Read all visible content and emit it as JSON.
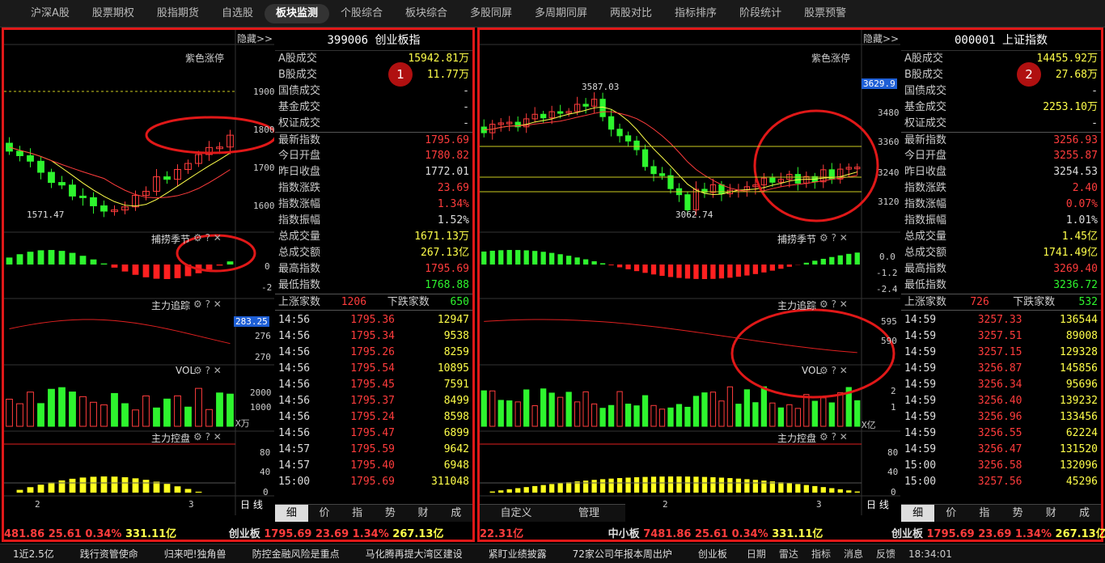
{
  "nav": [
    "沪深A股",
    "股票期权",
    "股指期货",
    "自选股",
    "板块监测",
    "个股综合",
    "板块综合",
    "多股同屏",
    "多周期同屏",
    "两股对比",
    "指标排序",
    "阶段统计",
    "股票预警"
  ],
  "nav_active": 4,
  "left": {
    "hide": "隐藏>>",
    "marker": "紫色涨停",
    "yaxis": [
      "1900",
      "1800",
      "1700",
      "1600"
    ],
    "low_label": "1571.47",
    "ind1": "捕捞季节",
    "ind1_axis": [
      "0",
      "-2"
    ],
    "ind2": "主力追踪",
    "ind2_axis": [
      "283.25",
      "276",
      "270"
    ],
    "vol": "VOL",
    "vol_axis": [
      "2000",
      "1000",
      "X万"
    ],
    "ind3": "主力控盘",
    "ind3_axis": [
      "80",
      "40",
      "0"
    ],
    "xlabels": [
      "2",
      "3"
    ],
    "period": "日 线",
    "badge": "1",
    "title": "399006  创业板指",
    "rows": [
      {
        "k": "A股成交",
        "v": "15942.81万",
        "c": "yel"
      },
      {
        "k": "B股成交",
        "v": "11.77万",
        "c": "yel"
      },
      {
        "k": "国债成交",
        "v": "-",
        "c": "wht"
      },
      {
        "k": "基金成交",
        "v": "-",
        "c": "wht"
      },
      {
        "k": "权证成交",
        "v": "-",
        "c": "wht"
      },
      {
        "k": "最新指数",
        "v": "1795.69",
        "c": "red"
      },
      {
        "k": "今日开盘",
        "v": "1780.82",
        "c": "red"
      },
      {
        "k": "昨日收盘",
        "v": "1772.01",
        "c": "wht"
      },
      {
        "k": "指数涨跌",
        "v": "23.69",
        "c": "red"
      },
      {
        "k": "指数涨幅",
        "v": "1.34%",
        "c": "red"
      },
      {
        "k": "指数振幅",
        "v": "1.52%",
        "c": "wht"
      },
      {
        "k": "总成交量",
        "v": "1671.13万",
        "c": "yel"
      },
      {
        "k": "总成交额",
        "v": "267.13亿",
        "c": "yel"
      },
      {
        "k": "最高指数",
        "v": "1795.69",
        "c": "red"
      },
      {
        "k": "最低指数",
        "v": "1768.88",
        "c": "grn"
      }
    ],
    "updown": {
      "up_label": "上涨家数",
      "up": "1206",
      "down_label": "下跌家数",
      "down": "650"
    },
    "ticks": [
      [
        "14:56",
        "1795.36",
        "12947"
      ],
      [
        "14:56",
        "1795.34",
        "9538"
      ],
      [
        "14:56",
        "1795.26",
        "8259"
      ],
      [
        "14:56",
        "1795.54",
        "10895"
      ],
      [
        "14:56",
        "1795.45",
        "7591"
      ],
      [
        "14:56",
        "1795.37",
        "8499"
      ],
      [
        "14:56",
        "1795.24",
        "8598"
      ],
      [
        "14:56",
        "1795.47",
        "6899"
      ],
      [
        "14:57",
        "1795.59",
        "9642"
      ],
      [
        "14:57",
        "1795.40",
        "6948"
      ],
      [
        "15:00",
        "1795.69",
        "311048"
      ]
    ],
    "btabs": [
      "细",
      "价",
      "指",
      "势",
      "财",
      "成"
    ],
    "status": [
      "481.86",
      "25.61",
      "0.34%",
      "331.11亿"
    ],
    "status2": [
      "创业板",
      "1795.69",
      "23.69",
      "1.34%",
      "267.13亿"
    ]
  },
  "right": {
    "hide": "隐藏>>",
    "marker": "紫色涨停",
    "yaxis": [
      "3629.9",
      "3480",
      "3360",
      "3240",
      "3120"
    ],
    "high_label": "3587.03",
    "low_label": "3062.74",
    "ind1": "捕捞季节",
    "ind1_axis": [
      "0.0",
      "-1.2",
      "-2.4"
    ],
    "ind2": "主力追踪",
    "ind2_axis": [
      "595",
      "590"
    ],
    "vol": "VOL",
    "vol_axis": [
      "2",
      "1",
      "X亿"
    ],
    "ind3": "主力控盘",
    "ind3_axis": [
      "80",
      "40",
      "0"
    ],
    "xlabels": [
      "2",
      "3"
    ],
    "period": "日 线",
    "badge": "2",
    "title": "000001  上证指数",
    "rows": [
      {
        "k": "A股成交",
        "v": "14455.92万",
        "c": "yel"
      },
      {
        "k": "B股成交",
        "v": "27.68万",
        "c": "yel"
      },
      {
        "k": "国债成交",
        "v": "-",
        "c": "wht"
      },
      {
        "k": "基金成交",
        "v": "2253.10万",
        "c": "yel"
      },
      {
        "k": "权证成交",
        "v": "-",
        "c": "wht"
      },
      {
        "k": "最新指数",
        "v": "3256.93",
        "c": "red"
      },
      {
        "k": "今日开盘",
        "v": "3255.87",
        "c": "red"
      },
      {
        "k": "昨日收盘",
        "v": "3254.53",
        "c": "wht"
      },
      {
        "k": "指数涨跌",
        "v": "2.40",
        "c": "red"
      },
      {
        "k": "指数涨幅",
        "v": "0.07%",
        "c": "red"
      },
      {
        "k": "指数振幅",
        "v": "1.01%",
        "c": "wht"
      },
      {
        "k": "总成交量",
        "v": "1.45亿",
        "c": "yel"
      },
      {
        "k": "总成交额",
        "v": "1741.49亿",
        "c": "yel"
      },
      {
        "k": "最高指数",
        "v": "3269.40",
        "c": "red"
      },
      {
        "k": "最低指数",
        "v": "3236.72",
        "c": "grn"
      }
    ],
    "updown": {
      "up_label": "上涨家数",
      "up": "726",
      "down_label": "下跌家数",
      "down": "532"
    },
    "ticks": [
      [
        "14:59",
        "3257.33",
        "136544"
      ],
      [
        "14:59",
        "3257.51",
        "89008"
      ],
      [
        "14:59",
        "3257.15",
        "129328"
      ],
      [
        "14:59",
        "3256.87",
        "145856"
      ],
      [
        "14:59",
        "3256.34",
        "95696"
      ],
      [
        "14:59",
        "3256.40",
        "139232"
      ],
      [
        "14:59",
        "3256.96",
        "133456"
      ],
      [
        "14:59",
        "3256.55",
        "62224"
      ],
      [
        "14:59",
        "3256.47",
        "131520"
      ],
      [
        "15:00",
        "3256.58",
        "132096"
      ],
      [
        "15:00",
        "3257.56",
        "45296"
      ]
    ],
    "btabs": [
      "细",
      "价",
      "指",
      "势",
      "财",
      "成"
    ],
    "custom": "自定义",
    "manage": "管理",
    "status": [
      "22.31亿",
      "中小板",
      "7481.86",
      "25.61",
      "0.34%",
      "331.11亿"
    ],
    "status2": [
      "创业板",
      "1795.69",
      "23.69",
      "1.34%",
      "267.13亿"
    ]
  },
  "bottom": {
    "news": [
      "1近2.5亿",
      "践行资管使命",
      "归来吧!独角兽",
      "防控金融风险是重点",
      "马化腾再提大湾区建设",
      "紧盯业绩披露",
      "72家公司年报本周出炉",
      "创业板"
    ],
    "tools": [
      "日期",
      "雷达",
      "指标",
      "消息",
      "反馈"
    ],
    "time": "18:34:01"
  }
}
